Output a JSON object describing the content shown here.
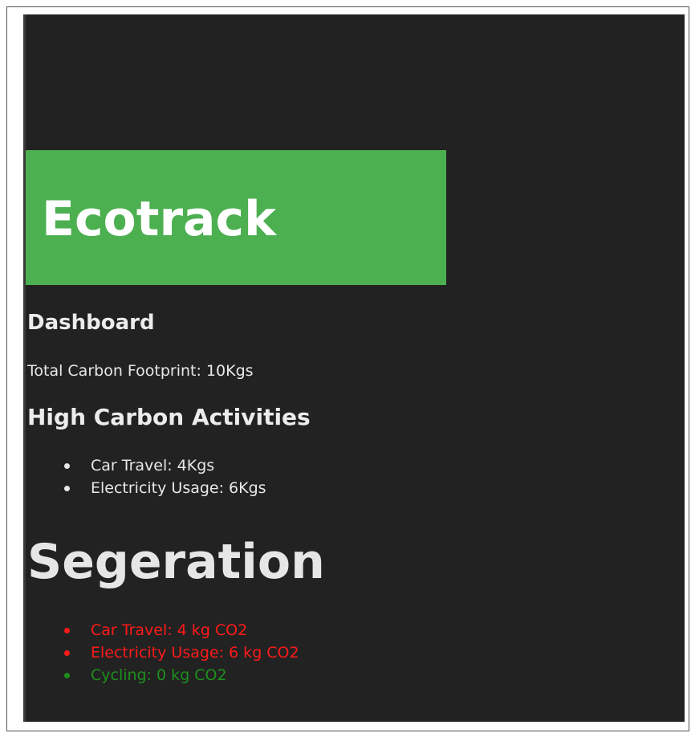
{
  "header": {
    "title": "Ecotrack",
    "brand_color": "#4caf50"
  },
  "dashboard": {
    "heading": "Dashboard",
    "total_footprint": "Total Carbon Footprint: 10Kgs"
  },
  "high_carbon": {
    "heading": "High Carbon Activities",
    "items": [
      "Car Travel: 4Kgs",
      "Electricity Usage: 6Kgs"
    ]
  },
  "segregation": {
    "heading": "Segeration",
    "items": [
      {
        "label": "Car Travel: 4 kg CO2",
        "color": "#ff1a1a"
      },
      {
        "label": "Electricity Usage: 6 kg CO2",
        "color": "#ff1a1a"
      },
      {
        "label": "Cycling: 0 kg CO2",
        "color": "#1e8f1e"
      }
    ]
  }
}
